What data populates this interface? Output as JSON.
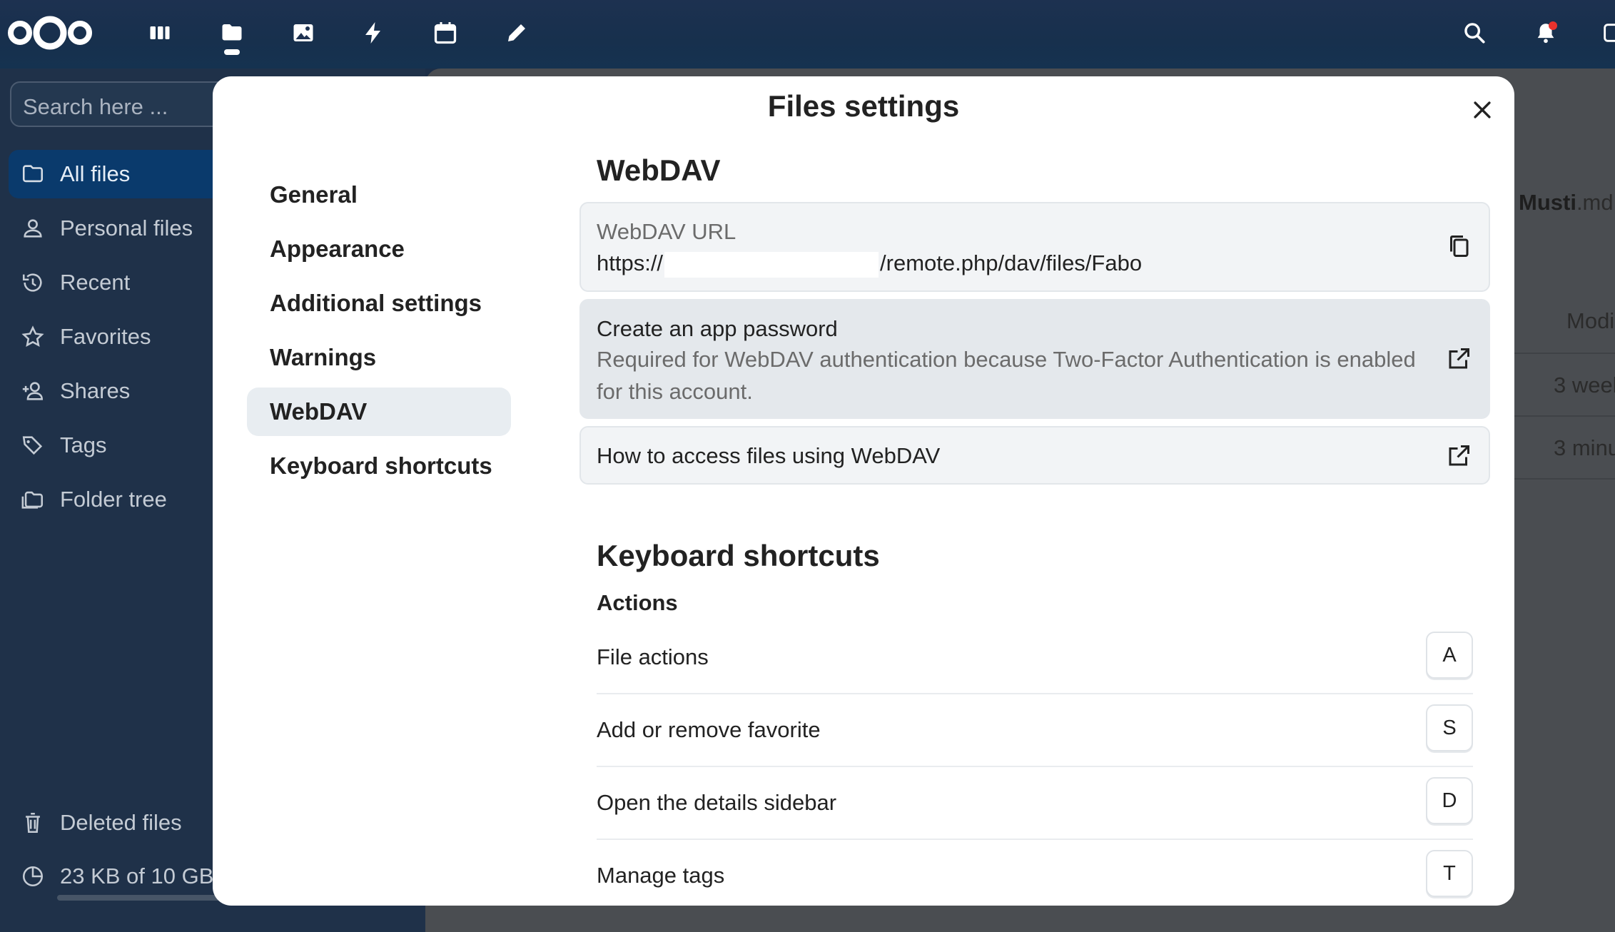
{
  "header": {
    "apps": [
      {
        "name": "dashboard-icon"
      },
      {
        "name": "files-icon",
        "active": true
      },
      {
        "name": "photos-icon"
      },
      {
        "name": "activity-icon"
      },
      {
        "name": "calendar-icon"
      },
      {
        "name": "notes-icon"
      }
    ],
    "right_icons": [
      "search-icon",
      "bell-icon"
    ]
  },
  "sidebar": {
    "search_placeholder": "Search here ...",
    "items": [
      {
        "label": "All files",
        "icon": "folder-icon",
        "active": true
      },
      {
        "label": "Personal files",
        "icon": "person-icon"
      },
      {
        "label": "Recent",
        "icon": "history-icon"
      },
      {
        "label": "Favorites",
        "icon": "star-icon"
      },
      {
        "label": "Shares",
        "icon": "share-icon"
      },
      {
        "label": "Tags",
        "icon": "tag-icon"
      },
      {
        "label": "Folder tree",
        "icon": "folder-tree-icon"
      }
    ],
    "footer": [
      {
        "label": "Deleted files",
        "icon": "trash-icon"
      },
      {
        "label": "23 KB of 10 GB",
        "icon": "pie-chart-icon"
      }
    ],
    "quota_used_fraction": 0.02
  },
  "main_bg": {
    "filename_part": "Musti",
    "filename_ext": ".md",
    "column_header": "Modi",
    "rows": [
      "3 weel",
      "3 minu"
    ]
  },
  "modal": {
    "title": "Files settings",
    "nav": [
      {
        "label": "General"
      },
      {
        "label": "Appearance"
      },
      {
        "label": "Additional settings"
      },
      {
        "label": "Warnings"
      },
      {
        "label": "WebDAV",
        "active": true
      },
      {
        "label": "Keyboard shortcuts"
      }
    ],
    "webdav": {
      "title": "WebDAV",
      "url_label": "WebDAV URL",
      "url_prefix": "https://",
      "url_suffix": "/remote.php/dav/files/Fabo",
      "app_password_title": "Create an app password",
      "app_password_desc": "Required for WebDAV authentication because Two-Factor Authentication is enabled for this account.",
      "howto_label": "How to access files using WebDAV"
    },
    "shortcuts": {
      "title": "Keyboard shortcuts",
      "actions_title": "Actions",
      "items": [
        {
          "label": "File actions",
          "key": "A"
        },
        {
          "label": "Add or remove favorite",
          "key": "S"
        },
        {
          "label": "Open the details sidebar",
          "key": "D"
        },
        {
          "label": "Manage tags",
          "key": "T"
        }
      ]
    }
  }
}
